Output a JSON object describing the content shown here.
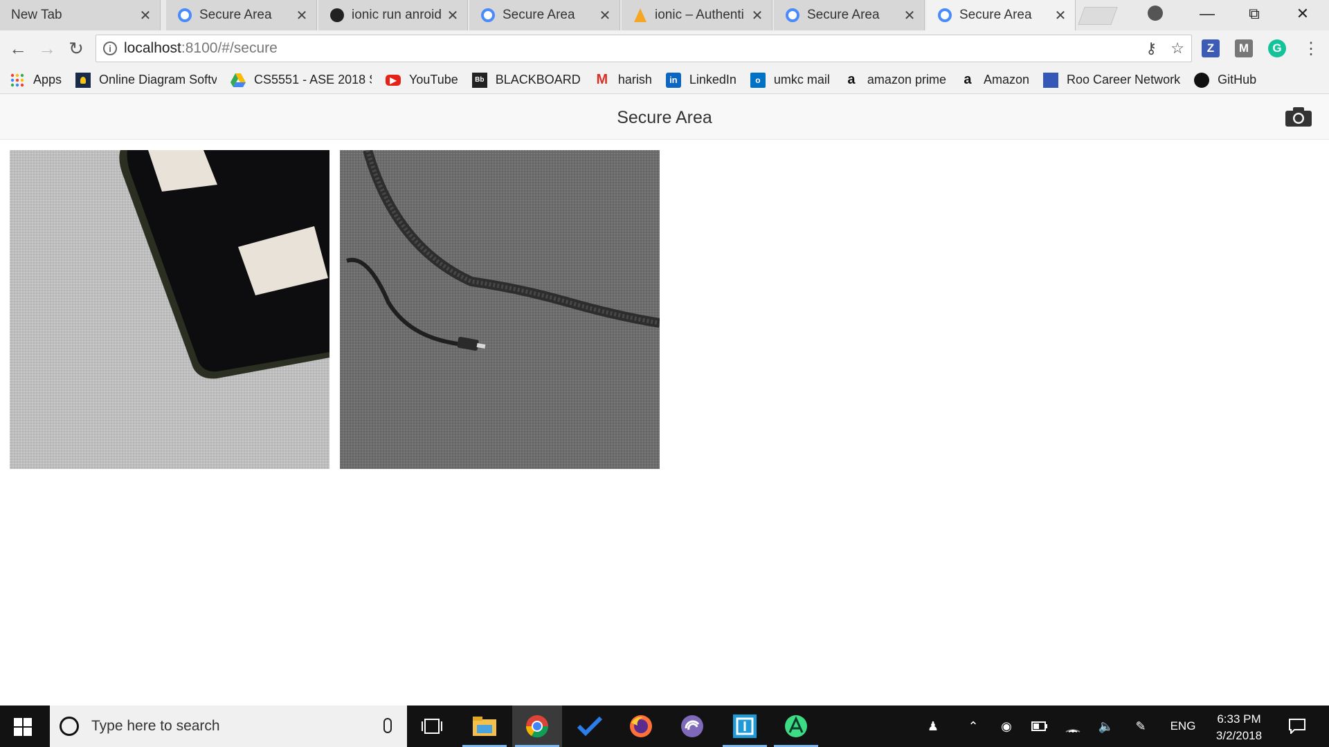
{
  "tabs": [
    {
      "title": "New Tab",
      "icon": "none-icon"
    },
    {
      "title": "Secure Area",
      "icon": "ionic-icon"
    },
    {
      "title": "ionic run anroid",
      "icon": "github-icon"
    },
    {
      "title": "Secure Area",
      "icon": "ionic-icon"
    },
    {
      "title": "ionic – Authenti",
      "icon": "firebase-icon"
    },
    {
      "title": "Secure Area",
      "icon": "ionic-icon"
    },
    {
      "title": "Secure Area",
      "icon": "ionic-icon",
      "active": true
    }
  ],
  "address": {
    "host": "localhost",
    "path": ":8100/#/secure"
  },
  "bookmarks": [
    {
      "label": "Apps",
      "icon": "apps-grid-icon"
    },
    {
      "label": "Online Diagram Softv",
      "icon": "diagram-icon"
    },
    {
      "label": "CS5551 - ASE 2018 S",
      "icon": "google-drive-icon"
    },
    {
      "label": "YouTube",
      "icon": "youtube-icon"
    },
    {
      "label": "BLACKBOARD",
      "icon": "blackboard-icon"
    },
    {
      "label": "harish",
      "icon": "gmail-icon"
    },
    {
      "label": "LinkedIn",
      "icon": "linkedin-icon"
    },
    {
      "label": "umkc  mail",
      "icon": "outlook-icon"
    },
    {
      "label": "amazon prime",
      "icon": "amazon-icon"
    },
    {
      "label": "Amazon",
      "icon": "amazon-icon"
    },
    {
      "label": "Roo Career Network",
      "icon": "roo-icon"
    },
    {
      "label": "GitHub",
      "icon": "github-icon"
    }
  ],
  "app": {
    "title": "Secure Area"
  },
  "photos": [
    {
      "subject": "phone on carpet"
    },
    {
      "subject": "cable on fabric"
    }
  ],
  "taskbar": {
    "search_placeholder": "Type here to search",
    "language": "ENG",
    "time": "6:33 PM",
    "date": "3/2/2018"
  }
}
